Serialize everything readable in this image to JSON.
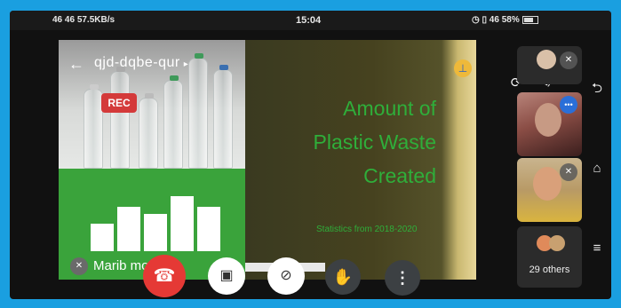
{
  "status_bar": {
    "network_left": "46 46",
    "speed": "57.5KB/s",
    "time": "15:04",
    "signal_right": "46 58%"
  },
  "meeting": {
    "code": "qjd-dqbe-qur",
    "rec_label": "REC",
    "presenter_name": "Marib    mo"
  },
  "slide": {
    "title_line1": "Amount of",
    "title_line2": "Plastic Waste",
    "title_line3": "Created",
    "subtitle": "Statistics from 2018-2020",
    "chart_bars_relative": [
      0.5,
      0.8,
      0.68,
      1.0,
      0.8
    ]
  },
  "participants": {
    "others_label": "29 others"
  },
  "colors": {
    "frame_border": "#1a9fe0",
    "end_call": "#e53935",
    "rec": "#d43a3a",
    "slide_text": "#2fae3a",
    "speaking_badge": "#2a6fd8"
  },
  "icons": {
    "back": "arrow-left-icon",
    "chevron": "chevron-right-icon",
    "pin": "pin-icon",
    "mic_off": "mic-off-icon",
    "end_call": "end-call-icon",
    "cam_off": "camera-off-icon",
    "hand": "raise-hand-icon",
    "more": "more-vertical-icon",
    "switch_camera": "switch-camera-icon",
    "audio": "audio-output-icon"
  }
}
